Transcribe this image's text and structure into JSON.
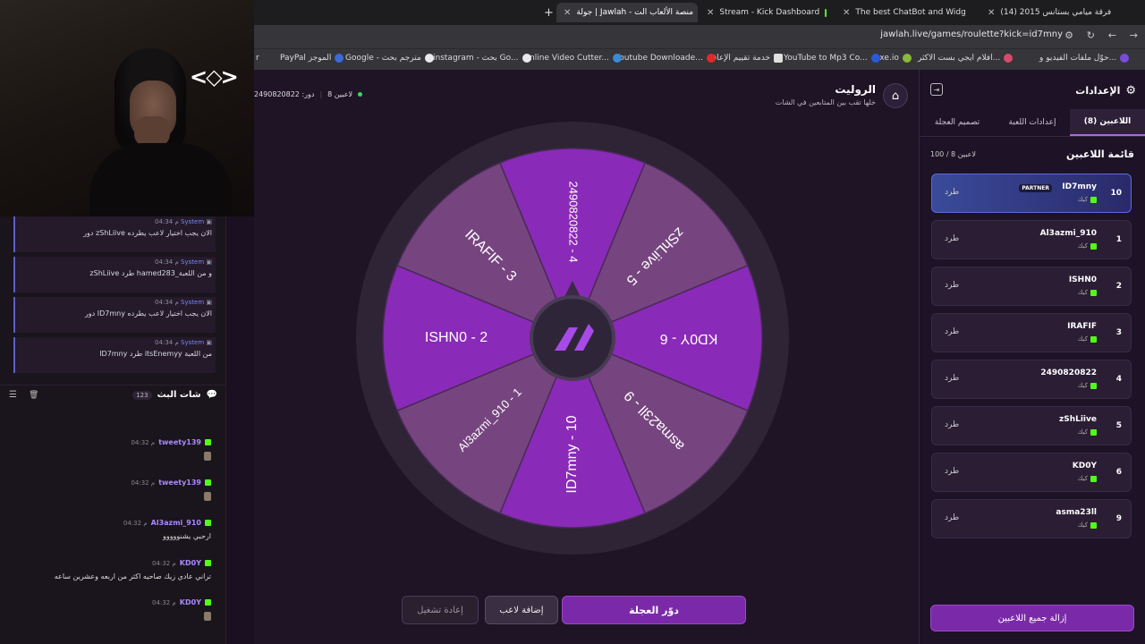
{
  "browser": {
    "tabs": [
      {
        "label": "(14) فرقة ميامي بستانس 2015"
      },
      {
        "label": "The best ChatBot and Widg"
      },
      {
        "label": "Stream - Kick Dashboard"
      },
      {
        "label": "جولة | Jawlah - منصة الألعاب الت"
      }
    ],
    "url": "jawlah.live/games/roulette?kick=id7mny",
    "bookmarks": [
      "حوّل ملفات الفيديو و...",
      "افلام ايجي بست الاكثر...",
      "exe.io",
      "YouTube to Mp3 Co...",
      "خدمة تقييم الإعاقة",
      "Youtube Downloade...",
      "Online Video Cutter...",
      "instagram - بحث Go...",
      "Google - مترجم بحث",
      "PayPal الموجز",
      "r"
    ]
  },
  "webcam": {
    "logo": "<◇>"
  },
  "chat": {
    "system_messages": [
      {
        "time": "04:34 م",
        "sender": "System",
        "text": "دور zShLiive الان يجب اختيار لاعب يطرده"
      },
      {
        "time": "04:34 م",
        "sender": "System",
        "text": "zShLiive طرد hamed283_و من اللعبة"
      },
      {
        "time": "04:34 م",
        "sender": "System",
        "text": "دور ID7mny الان يجب اختيار لاعب يطرده"
      },
      {
        "time": "04:34 م",
        "sender": "System",
        "text": "ID7mny طرد itsEnemyy من اللعبة"
      }
    ],
    "header": {
      "title": "شات البث",
      "count": "123"
    },
    "messages": [
      {
        "name": "tweety139",
        "time": "04:32 م",
        "text": ""
      },
      {
        "name": "tweety139",
        "time": "04:32 م",
        "text": ""
      },
      {
        "name": "Al3azmi_910",
        "time": "04:32 م",
        "text": "ارحبي يشنووووو"
      },
      {
        "name": "KD0Y",
        "time": "04:32 م",
        "text": "تراني عادي زيك صاحيه اكثر من اربعه وعشرين ساعه"
      },
      {
        "name": "KD0Y",
        "time": "04:32 م",
        "text": ""
      }
    ]
  },
  "game": {
    "title": "الروليت",
    "subtitle": "خلها تقب بين المتابعين في الشات",
    "player_count": "8 لاعبين",
    "turn": "دور: 2490820822"
  },
  "wheel": {
    "segments": [
      {
        "label": "2490820822 - 4",
        "shade": "dark"
      },
      {
        "label": "zShLiive - 5",
        "shade": "light"
      },
      {
        "label": "KD0Y - 6",
        "shade": "dark"
      },
      {
        "label": "asma23ll - 9",
        "shade": "light"
      },
      {
        "label": "ID7mny - 10",
        "shade": "dark"
      },
      {
        "label": "Al3azmi_910 - 1",
        "shade": "light"
      },
      {
        "label": "ISHN0 - 2",
        "shade": "dark"
      },
      {
        "label": "IRAFIF - 3",
        "shade": "light"
      }
    ],
    "colors": {
      "dark": "#8a2ab8",
      "light": "#76457f",
      "rim": "#2e2435"
    }
  },
  "controls": {
    "spin": "دوّر العجلة",
    "add_player": "إضافة لاعب",
    "restart": "إعادة تشغيل"
  },
  "settings": {
    "title": "الإعدادات",
    "tabs": [
      "اللاعبين (8)",
      "إعدادات اللعبة",
      "تصميم العجلة"
    ],
    "list_title": "قائمة اللاعبين",
    "capacity": "100 / 8 لاعبين",
    "players": [
      {
        "rank": "10",
        "name": "ID7mny",
        "platform": "كيك",
        "badge": "PARTNER",
        "kick": "طرد"
      },
      {
        "rank": "1",
        "name": "Al3azmi_910",
        "platform": "كيك",
        "kick": "طرد"
      },
      {
        "rank": "2",
        "name": "ISHN0",
        "platform": "كيك",
        "kick": "طرد"
      },
      {
        "rank": "3",
        "name": "IRAFIF",
        "platform": "كيك",
        "kick": "طرد"
      },
      {
        "rank": "4",
        "name": "2490820822",
        "platform": "كيك",
        "kick": "طرد"
      },
      {
        "rank": "5",
        "name": "zShLiive",
        "platform": "كيك",
        "kick": "طرد"
      },
      {
        "rank": "6",
        "name": "KD0Y",
        "platform": "كيك",
        "kick": "طرد"
      },
      {
        "rank": "9",
        "name": "asma23ll",
        "platform": "كيك",
        "kick": "طرد"
      }
    ],
    "remove_all": "إزالة جميع اللاعبين"
  }
}
